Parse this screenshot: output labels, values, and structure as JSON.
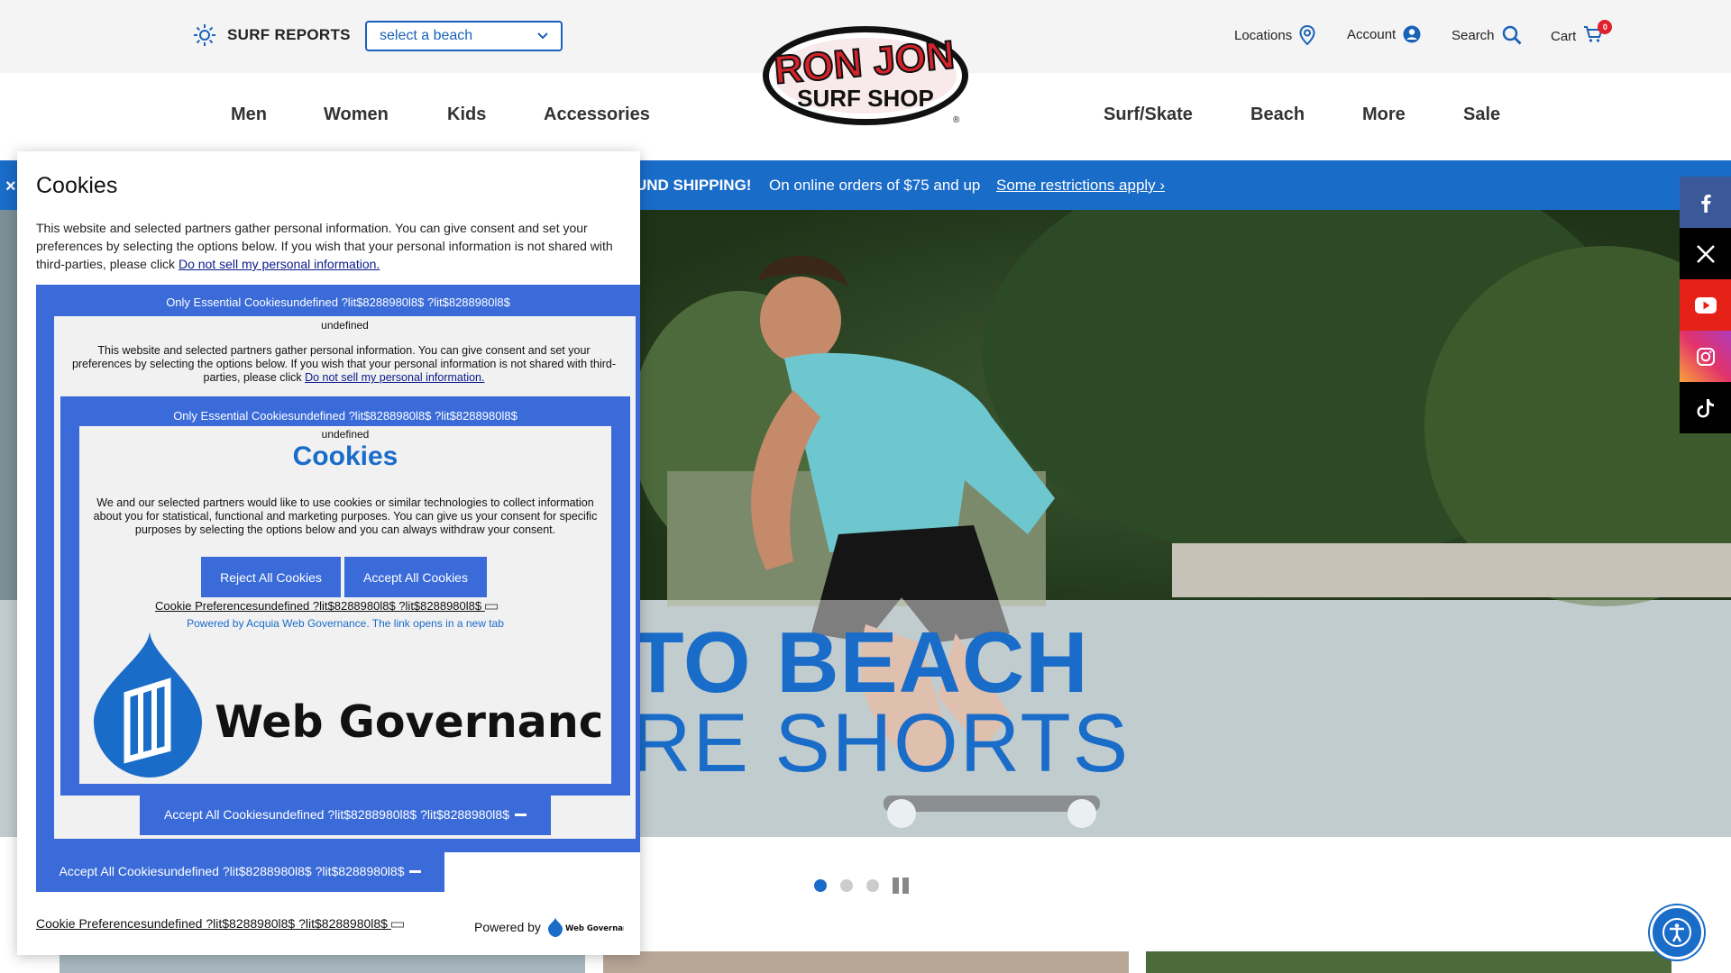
{
  "utility": {
    "surf_reports": "SURF REPORTS",
    "beach_select": "select a beach",
    "locations": "Locations",
    "account": "Account",
    "search": "Search",
    "cart": "Cart",
    "cart_count": "0"
  },
  "logo": {
    "line1": "RON JON",
    "line2": "SURF SHOP",
    "mark": "®"
  },
  "nav": {
    "men": "Men",
    "women": "Women",
    "kids": "Kids",
    "accessories": "Accessories",
    "surf_skate": "Surf/Skate",
    "beach": "Beach",
    "more": "More",
    "sale": "Sale"
  },
  "promo": {
    "close": "×",
    "text": "UND SHIPPING!",
    "sub": "On online orders of $75 and up",
    "link": "Some restrictions apply ›"
  },
  "hero": {
    "title": "TO BEACH",
    "subtitle": "RE SHORTS"
  },
  "cookie": {
    "title": "Cookies",
    "desc_prefix": "This website and selected partners gather personal information. You can give consent and set your preferences by selecting the options below. If you wish that your personal information is not shared with third-parties, please click ",
    "desc_link": "Do not sell my personal information.",
    "essential": "Only Essential Cookiesundefined ?lit$8288980l8$ ?lit$8288980l8$",
    "undefined": "undefined",
    "inner_title": "Cookies",
    "inner_desc": "We and our selected partners would like to use cookies or similar technologies to collect information about you for statistical, functional and marketing purposes. You can give us your consent for specific purposes by selecting the options below and you can always withdraw your consent.",
    "reject_all": "Reject All Cookies",
    "accept_all": "Accept All Cookies",
    "pref_link": "Cookie Preferencesundefined ?lit$8288980l8$ ?lit$8288980l8$",
    "powered_link": "Powered by Acquia Web Governance. The link opens in a new tab",
    "wg_text": "Web Governance",
    "accept_inner": "Accept All Cookiesundefined ?lit$8288980l8$ ?lit$8288980l8$",
    "accept_outer": "Accept All Cookiesundefined ?lit$8288980l8$ ?lit$8288980l8$",
    "bottom_pref": "Cookie Preferencesundefined ?lit$8288980l8$ ?lit$8288980l8$",
    "powered_by": "Powered by",
    "powered_brand": "Web Governance"
  },
  "social": [
    "facebook-icon",
    "x-icon",
    "youtube-icon",
    "instagram-icon",
    "tiktok-icon"
  ],
  "colors": {
    "brand_blue": "#1a6cc9",
    "cookie_blue": "#3a6bd8",
    "sale_red": "#e0202a"
  }
}
